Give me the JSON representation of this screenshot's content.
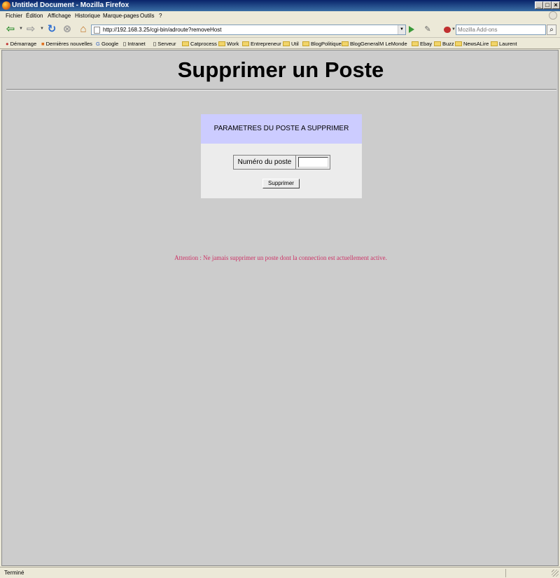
{
  "window": {
    "title": "Untitled Document - Mozilla Firefox"
  },
  "menu": [
    "Fichier",
    "Édition",
    "Affichage",
    "Historique",
    "Marque-pages",
    "Outils",
    "?"
  ],
  "nav": {
    "url": "http://192.168.3.25/cgi-bin/adroute?removeHost",
    "search_placeholder": "Mozilla Add-ons"
  },
  "bookmarks": [
    "Démarrage",
    "Dernières nouvelles",
    "Google",
    "Intranet",
    "Serveur",
    "Catprocess",
    "Work",
    "Entrepreneur",
    "Util",
    "BlogPolitique",
    "BlogGeneral",
    "LeMonde",
    "Ebay",
    "Buzz",
    "NewsALire",
    "Laurent"
  ],
  "page": {
    "title": "Supprimer un Poste",
    "panel_header": "PARAMETRES DU POSTE A SUPPRIMER",
    "field_label": "Numéro du poste",
    "field_value": "",
    "submit_label": "Supprimer",
    "warning": "Attention : Ne jamais supprimer un poste dont la connection est actuellement active."
  },
  "status": {
    "text": "Terminé"
  },
  "colors": {
    "panel_header_bg": "#ccccff",
    "panel_bg": "#ececec",
    "page_bg": "#cccccc",
    "warning": "#cc3366"
  }
}
